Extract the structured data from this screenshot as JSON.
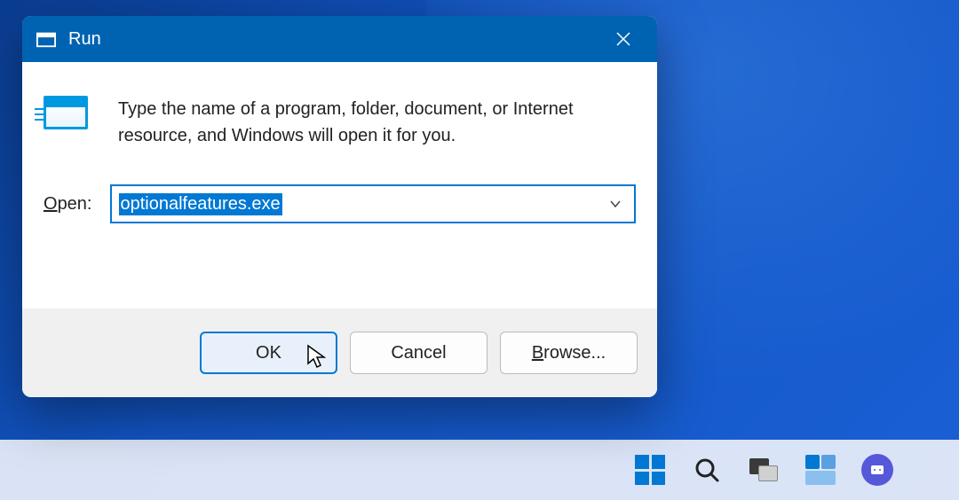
{
  "dialog": {
    "title": "Run",
    "description": "Type the name of a program, folder, document, or Internet resource, and Windows will open it for you.",
    "open_label_prefix": "O",
    "open_label_rest": "pen:",
    "input_value": "optionalfeatures.exe",
    "buttons": {
      "ok": "OK",
      "cancel": "Cancel",
      "browse_prefix": "B",
      "browse_rest": "rowse..."
    }
  },
  "taskbar": {
    "items": [
      "start",
      "search",
      "task-view",
      "widgets",
      "chat"
    ]
  }
}
